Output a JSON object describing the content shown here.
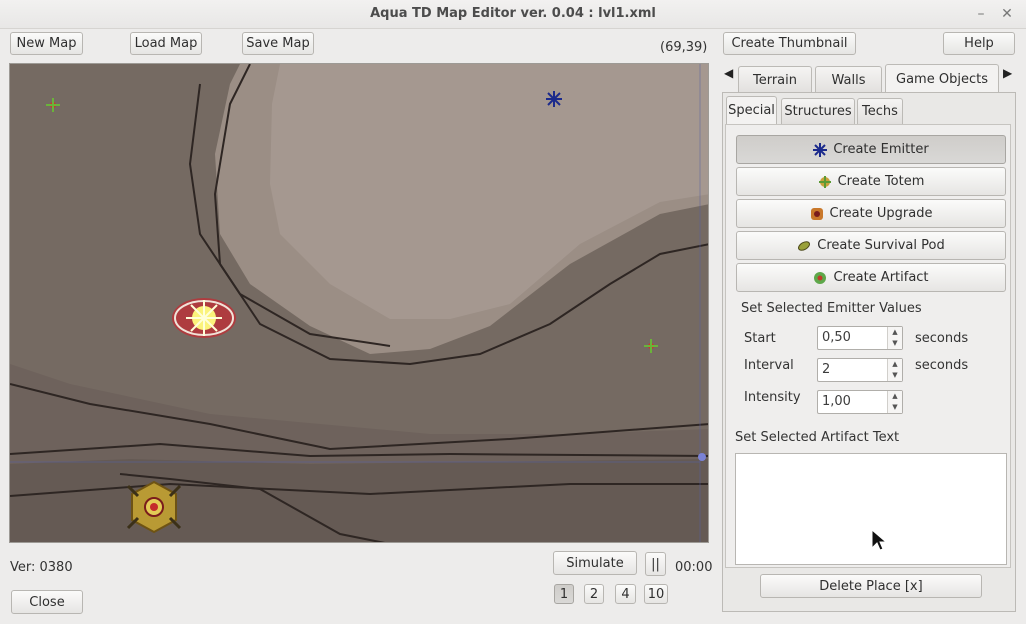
{
  "window": {
    "title": "Aqua TD Map Editor ver. 0.04 : lvl1.xml"
  },
  "toolbar": {
    "new_map": "New Map",
    "load_map": "Load Map",
    "save_map": "Save Map",
    "coords": "(69,39)",
    "create_thumbnail": "Create Thumbnail",
    "help": "Help"
  },
  "tabs": [
    "Terrain",
    "Walls",
    "Game Objects"
  ],
  "subtabs": [
    "Special",
    "Structures",
    "Techs"
  ],
  "special": {
    "buttons": [
      "Create Emitter",
      "Create Totem",
      "Create Upgrade",
      "Create Survival Pod",
      "Create Artifact"
    ],
    "emitter_heading": "Set Selected Emitter Values",
    "start_label": "Start",
    "start_value": "0,50",
    "start_unit": "seconds",
    "interval_label": "Interval",
    "interval_value": "2",
    "interval_unit": "seconds",
    "intensity_label": "Intensity",
    "intensity_value": "1,00",
    "artifact_heading": "Set Selected Artifact Text",
    "artifact_text": ""
  },
  "delete_button": "Delete Place [x]",
  "footer": {
    "version": "Ver: 0380",
    "close": "Close",
    "simulate": "Simulate",
    "pause": "||",
    "timer": "00:00",
    "speeds": [
      "1",
      "2",
      "4",
      "10"
    ]
  }
}
